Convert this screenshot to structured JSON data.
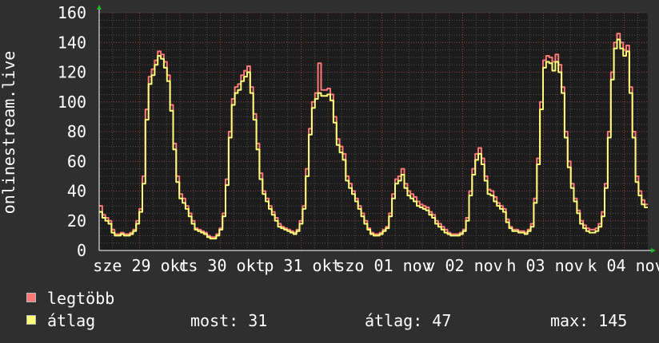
{
  "chart_data": {
    "type": "line",
    "ylabel": "onlinestream.live",
    "ylim": [
      0,
      160
    ],
    "yticks": [
      0,
      20,
      40,
      60,
      80,
      100,
      120,
      140,
      160
    ],
    "xlim": [
      0,
      163
    ],
    "xtick_labels": [
      {
        "label": "sze 29 okt",
        "x": 12
      },
      {
        "label": "cs 30 okt",
        "x": 36
      },
      {
        "label": "p 31 okt",
        "x": 60
      },
      {
        "label": "szo 01 nov",
        "x": 84
      },
      {
        "label": "v 02 nov",
        "x": 108
      },
      {
        "label": "h 03 nov",
        "x": 132
      },
      {
        "label": "k 04 nov",
        "x": 156
      }
    ],
    "grid": true,
    "series": [
      {
        "name": "legtöbb",
        "color": "#ff7777",
        "values": [
          30,
          24,
          22,
          20,
          14,
          11,
          11,
          12,
          11,
          11,
          12,
          14,
          20,
          28,
          50,
          95,
          117,
          122,
          128,
          134,
          132,
          127,
          118,
          98,
          72,
          50,
          38,
          35,
          30,
          25,
          20,
          15,
          14,
          13,
          12,
          10,
          9,
          9,
          11,
          15,
          25,
          48,
          80,
          102,
          110,
          112,
          118,
          121,
          124,
          110,
          92,
          72,
          52,
          40,
          35,
          30,
          26,
          22,
          18,
          16,
          15,
          14,
          13,
          12,
          14,
          20,
          30,
          55,
          82,
          100,
          106,
          126,
          108,
          108,
          109,
          105,
          90,
          75,
          70,
          65,
          50,
          45,
          40,
          35,
          30,
          25,
          20,
          15,
          12,
          11,
          11,
          12,
          14,
          16,
          25,
          38,
          48,
          50,
          55,
          45,
          40,
          38,
          36,
          33,
          31,
          30,
          29,
          26,
          24,
          20,
          18,
          16,
          14,
          12,
          11,
          11,
          11,
          12,
          14,
          22,
          40,
          55,
          65,
          69,
          62,
          50,
          41,
          40,
          36,
          32,
          30,
          28,
          21,
          16,
          14,
          14,
          13,
          13,
          12,
          14,
          18,
          35,
          62,
          100,
          128,
          131,
          130,
          127,
          132,
          125,
          110,
          80,
          60,
          45,
          35,
          27,
          20,
          17,
          15,
          14,
          14,
          15,
          18,
          26,
          45,
          80,
          120,
          140,
          146,
          140,
          135,
          138,
          110,
          80,
          50,
          40,
          34,
          31
        ],
        "values_mean_series": false
      },
      {
        "name": "átlag",
        "color": "#ffff77",
        "values": [
          26,
          22,
          20,
          18,
          12,
          10,
          10,
          11,
          10,
          10,
          11,
          13,
          18,
          26,
          45,
          88,
          112,
          118,
          125,
          131,
          129,
          123,
          114,
          94,
          68,
          46,
          35,
          32,
          28,
          23,
          18,
          14,
          13,
          12,
          11,
          9,
          8,
          8,
          10,
          14,
          23,
          44,
          76,
          98,
          106,
          108,
          114,
          117,
          120,
          106,
          88,
          68,
          48,
          38,
          33,
          28,
          24,
          20,
          16,
          15,
          14,
          13,
          12,
          11,
          13,
          18,
          28,
          50,
          78,
          96,
          102,
          106,
          104,
          104,
          105,
          101,
          86,
          71,
          66,
          61,
          47,
          42,
          38,
          33,
          28,
          23,
          18,
          14,
          11,
          10,
          10,
          11,
          13,
          15,
          23,
          35,
          45,
          47,
          51,
          42,
          37,
          35,
          33,
          30,
          29,
          28,
          27,
          24,
          22,
          18,
          16,
          14,
          12,
          11,
          10,
          10,
          10,
          11,
          13,
          20,
          37,
          51,
          61,
          65,
          58,
          47,
          38,
          37,
          33,
          30,
          28,
          26,
          19,
          15,
          13,
          13,
          12,
          12,
          11,
          13,
          16,
          32,
          58,
          95,
          123,
          127,
          126,
          121,
          127,
          120,
          106,
          76,
          56,
          42,
          33,
          25,
          18,
          15,
          13,
          12,
          12,
          13,
          16,
          23,
          42,
          76,
          115,
          136,
          142,
          136,
          131,
          134,
          106,
          76,
          46,
          37,
          31,
          29
        ]
      }
    ]
  },
  "legend": {
    "items": [
      {
        "label": "legtöbb",
        "color": "#ff7777"
      },
      {
        "label": "átlag",
        "color": "#ffff77"
      }
    ],
    "stats": {
      "most": "most: 31",
      "atlag": "átlag: 47",
      "max": "max: 145"
    }
  }
}
